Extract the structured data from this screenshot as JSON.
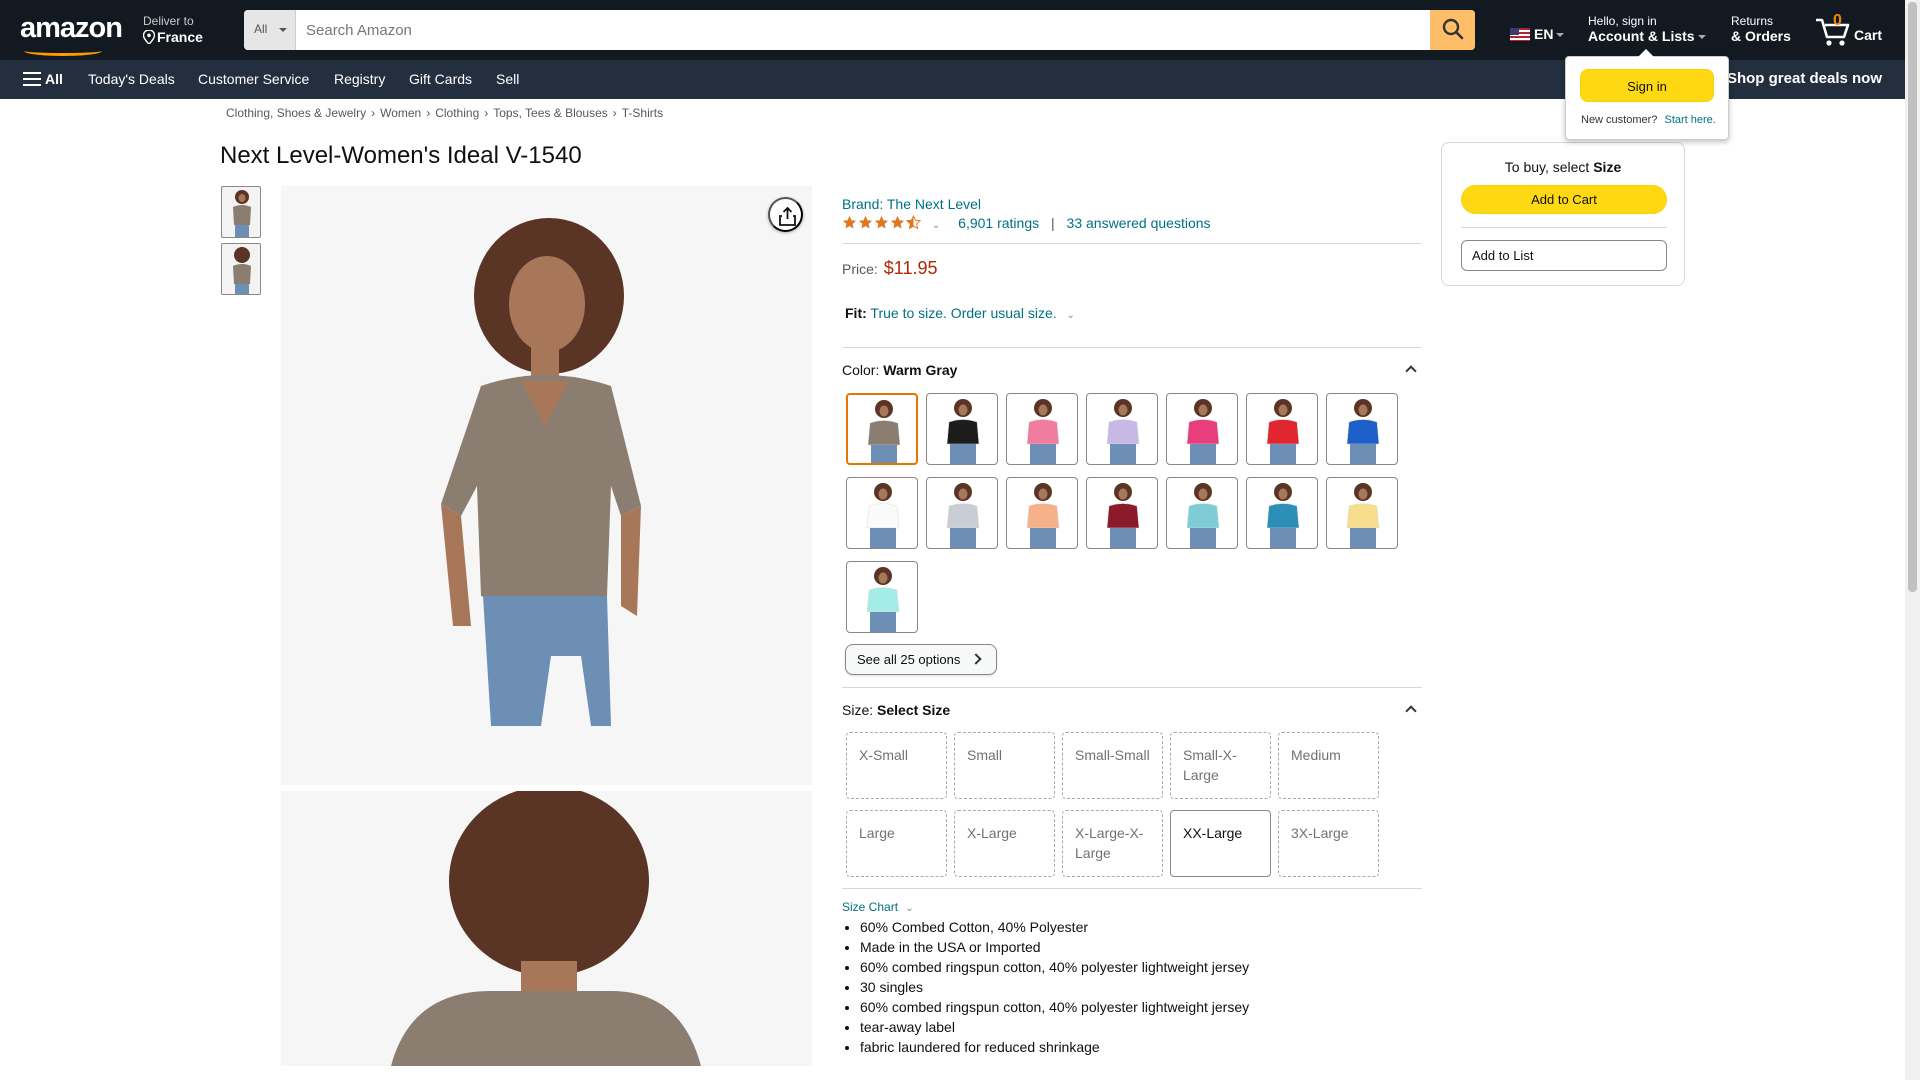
{
  "header": {
    "logo": "amazon",
    "deliver_line1": "Deliver to",
    "deliver_line2": "France",
    "search_category": "All",
    "search_placeholder": "Search Amazon",
    "language": "EN",
    "account_line1": "Hello, sign in",
    "account_line2": "Account & Lists",
    "orders_line1": "Returns",
    "orders_line2": "& Orders",
    "cart_count": "0",
    "cart_label": "Cart",
    "icons": [
      "location-pin-icon",
      "search-icon",
      "us-flag-icon",
      "cart-icon"
    ]
  },
  "nav": {
    "all": "All",
    "items": [
      "Today's Deals",
      "Customer Service",
      "Registry",
      "Gift Cards",
      "Sell"
    ],
    "promo": "Shop great deals now"
  },
  "breadcrumb": [
    "Clothing, Shoes & Jewelry",
    "Women",
    "Clothing",
    "Tops, Tees & Blouses",
    "T-Shirts"
  ],
  "product": {
    "title": "Next Level-Women's Ideal V-1540",
    "brand": "Brand: The Next Level",
    "rating_stars": 4.5,
    "ratings": "6,901 ratings",
    "separator": "|",
    "questions": "33 answered questions",
    "price_label": "Price:",
    "price": "$11.95",
    "fit_label": "Fit:",
    "fit_value": "True to size. Order usual size.",
    "color_label": "Color:",
    "color_value": "Warm Gray",
    "swatches": [
      "#8b7d6f",
      "#1c1c1c",
      "#f07ca0",
      "#c8b8e6",
      "#e83f7c",
      "#e0262f",
      "#1d5fc8",
      "#fafafa",
      "#c9ced6",
      "#f6b08a",
      "#8b1b28",
      "#7fcbd6",
      "#2b8fb8",
      "#f6de8e",
      "#a6ece6"
    ],
    "see_all": "See all 25 options",
    "size_label": "Size:",
    "size_value": "Select Size",
    "sizes": [
      "X-Small",
      "Small",
      "Small-Small",
      "Small-X-Large",
      "Medium",
      "Large",
      "X-Large",
      "X-Large-X-Large",
      "XX-Large",
      "3X-Large"
    ],
    "size_chart": "Size Chart",
    "bullets": [
      "60% Combed Cotton, 40% Polyester",
      "Made in the USA or Imported",
      "60% combed ringspun cotton, 40% polyester lightweight jersey",
      "30 singles",
      "60% combed ringspun cotton, 40% polyester lightweight jersey",
      "tear-away label",
      "fabric laundered for reduced shrinkage"
    ]
  },
  "buybox": {
    "prefix": "To buy, select ",
    "emph": "Size",
    "add_to_cart": "Add to Cart",
    "add_to_list": "Add to List"
  },
  "flyout": {
    "sign_in": "Sign in",
    "new_customer": "New customer?",
    "start_here": "Start here."
  },
  "colors": {
    "header_bg": "#131921",
    "nav_bg": "#232f3e",
    "accent": "#febd69",
    "button_yellow": "#ffd814",
    "price_red": "#b12704",
    "link": "#007185",
    "shirt": "#8b7d6f"
  }
}
